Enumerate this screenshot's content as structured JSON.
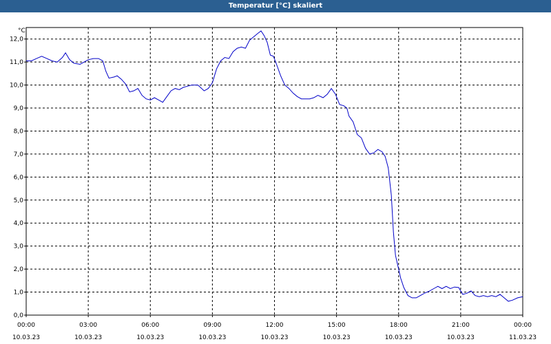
{
  "window": {
    "title": "Temperatur [°C] skaliert"
  },
  "chart_data": {
    "type": "line",
    "title": "Temperatur [°C] skaliert",
    "ylabel": "°C",
    "xlabel": "",
    "ylim": [
      0,
      12.5
    ],
    "xlim_hours": [
      0,
      24
    ],
    "grid": true,
    "line_color": "#0000c8",
    "y_ticks": [
      "0,0",
      "1,0",
      "2,0",
      "3,0",
      "4,0",
      "5,0",
      "6,0",
      "7,0",
      "8,0",
      "9,0",
      "10,0",
      "11,0",
      "12,0"
    ],
    "x_ticks": [
      {
        "time": "00:00",
        "date": "10.03.23"
      },
      {
        "time": "03:00",
        "date": "10.03.23"
      },
      {
        "time": "06:00",
        "date": "10.03.23"
      },
      {
        "time": "09:00",
        "date": "10.03.23"
      },
      {
        "time": "12:00",
        "date": "10.03.23"
      },
      {
        "time": "15:00",
        "date": "10.03.23"
      },
      {
        "time": "18:00",
        "date": "10.03.23"
      },
      {
        "time": "21:00",
        "date": "10.03.23"
      },
      {
        "time": "00:00",
        "date": "11.03.23"
      }
    ],
    "series": [
      {
        "values": [
          [
            0.0,
            11.05
          ],
          [
            0.25,
            11.05
          ],
          [
            0.5,
            11.15
          ],
          [
            0.75,
            11.25
          ],
          [
            1.0,
            11.15
          ],
          [
            1.25,
            11.05
          ],
          [
            1.5,
            11.0
          ],
          [
            1.75,
            11.2
          ],
          [
            1.9,
            11.4
          ],
          [
            2.1,
            11.1
          ],
          [
            2.3,
            10.95
          ],
          [
            2.6,
            10.9
          ],
          [
            2.8,
            11.0
          ],
          [
            3.0,
            11.1
          ],
          [
            3.25,
            11.15
          ],
          [
            3.5,
            11.15
          ],
          [
            3.7,
            11.05
          ],
          [
            3.85,
            10.6
          ],
          [
            4.0,
            10.3
          ],
          [
            4.25,
            10.35
          ],
          [
            4.4,
            10.4
          ],
          [
            4.6,
            10.25
          ],
          [
            4.8,
            10.05
          ],
          [
            5.0,
            9.7
          ],
          [
            5.2,
            9.75
          ],
          [
            5.4,
            9.85
          ],
          [
            5.6,
            9.55
          ],
          [
            5.8,
            9.4
          ],
          [
            6.0,
            9.35
          ],
          [
            6.2,
            9.45
          ],
          [
            6.4,
            9.35
          ],
          [
            6.6,
            9.25
          ],
          [
            6.8,
            9.5
          ],
          [
            7.0,
            9.75
          ],
          [
            7.2,
            9.85
          ],
          [
            7.4,
            9.8
          ],
          [
            7.6,
            9.9
          ],
          [
            7.8,
            9.95
          ],
          [
            8.0,
            10.0
          ],
          [
            8.3,
            10.0
          ],
          [
            8.6,
            9.75
          ],
          [
            8.8,
            9.85
          ],
          [
            9.0,
            10.1
          ],
          [
            9.2,
            10.7
          ],
          [
            9.4,
            11.05
          ],
          [
            9.6,
            11.2
          ],
          [
            9.8,
            11.15
          ],
          [
            10.0,
            11.45
          ],
          [
            10.2,
            11.6
          ],
          [
            10.4,
            11.65
          ],
          [
            10.6,
            11.6
          ],
          [
            10.8,
            11.95
          ],
          [
            11.0,
            12.1
          ],
          [
            11.2,
            12.25
          ],
          [
            11.35,
            12.35
          ],
          [
            11.5,
            12.15
          ],
          [
            11.65,
            11.85
          ],
          [
            11.8,
            11.3
          ],
          [
            11.95,
            11.25
          ],
          [
            12.1,
            10.9
          ],
          [
            12.3,
            10.4
          ],
          [
            12.5,
            10.0
          ],
          [
            12.7,
            9.85
          ],
          [
            12.9,
            9.65
          ],
          [
            13.1,
            9.5
          ],
          [
            13.3,
            9.4
          ],
          [
            13.5,
            9.4
          ],
          [
            13.7,
            9.4
          ],
          [
            13.9,
            9.45
          ],
          [
            14.1,
            9.55
          ],
          [
            14.35,
            9.45
          ],
          [
            14.55,
            9.6
          ],
          [
            14.75,
            9.85
          ],
          [
            14.95,
            9.6
          ],
          [
            15.15,
            9.15
          ],
          [
            15.35,
            9.1
          ],
          [
            15.5,
            9.0
          ],
          [
            15.6,
            8.65
          ],
          [
            15.8,
            8.4
          ],
          [
            16.0,
            7.85
          ],
          [
            16.2,
            7.7
          ],
          [
            16.4,
            7.25
          ],
          [
            16.6,
            7.0
          ],
          [
            16.8,
            7.05
          ],
          [
            17.0,
            7.2
          ],
          [
            17.2,
            7.1
          ],
          [
            17.35,
            6.9
          ],
          [
            17.5,
            6.4
          ],
          [
            17.65,
            5.2
          ],
          [
            17.75,
            3.6
          ],
          [
            17.85,
            2.6
          ],
          [
            17.95,
            2.2
          ],
          [
            18.1,
            1.6
          ],
          [
            18.25,
            1.2
          ],
          [
            18.45,
            0.85
          ],
          [
            18.65,
            0.75
          ],
          [
            18.85,
            0.75
          ],
          [
            19.05,
            0.85
          ],
          [
            19.25,
            0.95
          ],
          [
            19.5,
            1.05
          ],
          [
            19.7,
            1.15
          ],
          [
            19.9,
            1.25
          ],
          [
            20.1,
            1.15
          ],
          [
            20.3,
            1.25
          ],
          [
            20.5,
            1.15
          ],
          [
            20.7,
            1.22
          ],
          [
            20.9,
            1.2
          ],
          [
            21.1,
            0.9
          ],
          [
            21.3,
            0.95
          ],
          [
            21.5,
            1.05
          ],
          [
            21.7,
            0.85
          ],
          [
            21.9,
            0.8
          ],
          [
            22.1,
            0.85
          ],
          [
            22.3,
            0.8
          ],
          [
            22.5,
            0.85
          ],
          [
            22.7,
            0.8
          ],
          [
            22.9,
            0.9
          ],
          [
            23.1,
            0.75
          ],
          [
            23.3,
            0.6
          ],
          [
            23.5,
            0.65
          ],
          [
            23.75,
            0.75
          ],
          [
            24.0,
            0.8
          ]
        ]
      }
    ]
  }
}
